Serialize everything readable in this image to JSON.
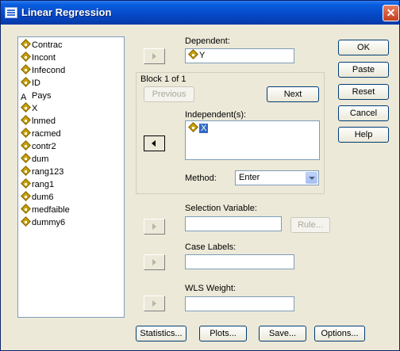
{
  "window": {
    "title": "Linear Regression",
    "close_glyph": "✕"
  },
  "variables": [
    {
      "label": "Contrac",
      "icon": "scale-variable-icon",
      "kind": "scale"
    },
    {
      "label": "Incont",
      "icon": "scale-variable-icon",
      "kind": "scale"
    },
    {
      "label": "Infecond",
      "icon": "scale-variable-icon",
      "kind": "scale"
    },
    {
      "label": "ID",
      "icon": "scale-variable-icon",
      "kind": "scale"
    },
    {
      "label": "Pays",
      "icon": "string-variable-icon",
      "kind": "string",
      "glyph": "A"
    },
    {
      "label": "X",
      "icon": "scale-variable-icon",
      "kind": "scale"
    },
    {
      "label": "lnmed",
      "icon": "scale-variable-icon",
      "kind": "scale"
    },
    {
      "label": "racmed",
      "icon": "scale-variable-icon",
      "kind": "scale"
    },
    {
      "label": "contr2",
      "icon": "scale-variable-icon",
      "kind": "scale"
    },
    {
      "label": "dum",
      "icon": "scale-variable-icon",
      "kind": "scale"
    },
    {
      "label": "rang123",
      "icon": "scale-variable-icon",
      "kind": "scale"
    },
    {
      "label": "rang1",
      "icon": "scale-variable-icon",
      "kind": "scale"
    },
    {
      "label": "dum6",
      "icon": "scale-variable-icon",
      "kind": "scale"
    },
    {
      "label": "medfaible",
      "icon": "scale-variable-icon",
      "kind": "scale"
    },
    {
      "label": "dummy6",
      "icon": "scale-variable-icon",
      "kind": "scale"
    }
  ],
  "dependent": {
    "label": "Dependent:",
    "value": "Y"
  },
  "block": {
    "label": "Block 1 of 1",
    "previous": "Previous",
    "next": "Next"
  },
  "independents": {
    "label": "Independent(s):",
    "items": [
      "X"
    ]
  },
  "method": {
    "label": "Method:",
    "value": "Enter"
  },
  "selection": {
    "label": "Selection Variable:",
    "value": "",
    "rule": "Rule..."
  },
  "case_labels": {
    "label": "Case Labels:",
    "value": ""
  },
  "wls": {
    "label": "WLS Weight:",
    "value": ""
  },
  "side_buttons": [
    "OK",
    "Paste",
    "Reset",
    "Cancel",
    "Help"
  ],
  "bottom_buttons": [
    "Statistics...",
    "Plots...",
    "Save...",
    "Options..."
  ]
}
